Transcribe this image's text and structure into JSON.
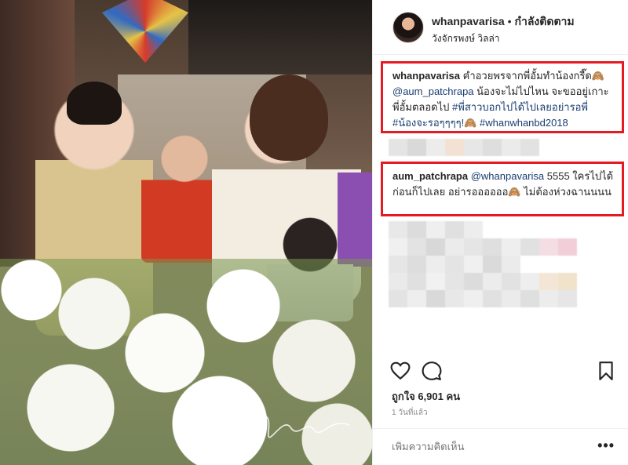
{
  "photo": {
    "alt": "",
    "signature": "Jakaw..."
  },
  "header": {
    "username": "whanpavarisa",
    "separator": "•",
    "follow_status": "กำลังติดตาม",
    "location": "วังจักรพงษ์ วิลล่า"
  },
  "comments": [
    {
      "user": "whanpavarisa",
      "text_1": "คำอวยพรจากพี่อั้มทำน้องกรี๊ด",
      "emoji": "🙈",
      "mention": "@aum_patchrapa",
      "text_2": "น้องจะไม่ไปไหน จะขออยู่เกาะพี่อั้มตลอดไป",
      "tag_1": "#พี่สาวบอกไปได้ไปเลยอย่ารอพี่",
      "tag_2": "#น้องจะรอๆๆๆๆ!",
      "tag_3": "#whanwhanbd2018"
    },
    {
      "user": "aum_patchrapa",
      "mention": "@whanpavarisa",
      "text_1": "5555 ใครไปได้ก่อนก็ไปเลย อย่ารออออออ",
      "emoji": "🙈",
      "text_2": "ไม่ต้องห่วงฉานนนน"
    }
  ],
  "actions": {
    "like_icon": "heart-icon",
    "comment_icon": "comment-icon",
    "save_icon": "bookmark-icon"
  },
  "likes_text": "ถูกใจ 6,901 คน",
  "time_text": "1 วันที่แล้ว",
  "add_comment_placeholder": "เพิ่มความคิดเห็น",
  "more_label": "•••",
  "colors": {
    "highlight_border": "#e51b24",
    "hashtag": "#1a3d70",
    "muted": "#8e8e8e"
  }
}
